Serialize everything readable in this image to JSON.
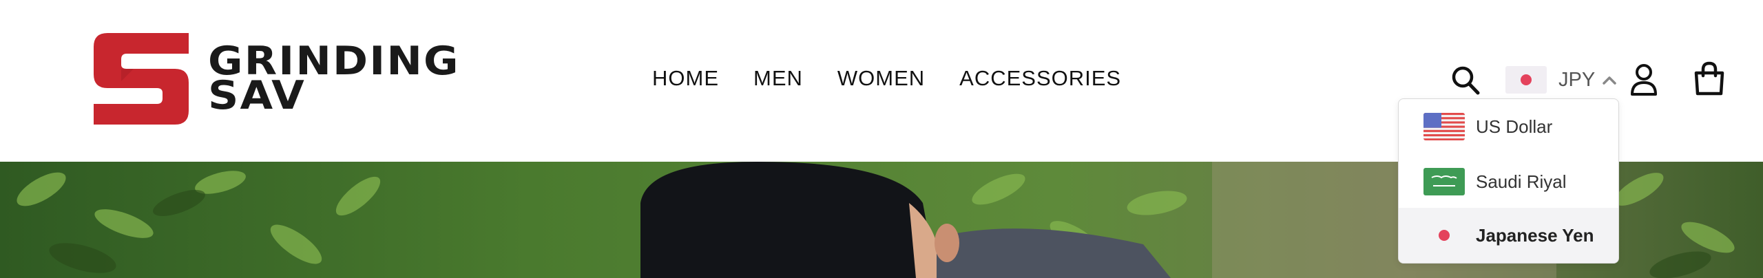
{
  "brand": {
    "line1": "GRINDING",
    "line2": "SAV",
    "accent_color": "#c8262e"
  },
  "nav": {
    "items": [
      "HOME",
      "MEN",
      "WOMEN",
      "ACCESSORIES"
    ]
  },
  "header_icons": {
    "search": "search-icon",
    "account": "user-icon",
    "cart": "shopping-bag-icon"
  },
  "currency": {
    "selected_code": "JPY",
    "toggle_icon": "chevron-up-icon",
    "options": [
      {
        "label": "US Dollar",
        "flag": "us-flag-icon",
        "selected": false
      },
      {
        "label": "Saudi Riyal",
        "flag": "saudi-flag-icon",
        "selected": false
      },
      {
        "label": "Japanese Yen",
        "flag": "japan-flag-icon",
        "selected": true
      }
    ]
  },
  "hero": {
    "description_icon": "hero-photo"
  }
}
